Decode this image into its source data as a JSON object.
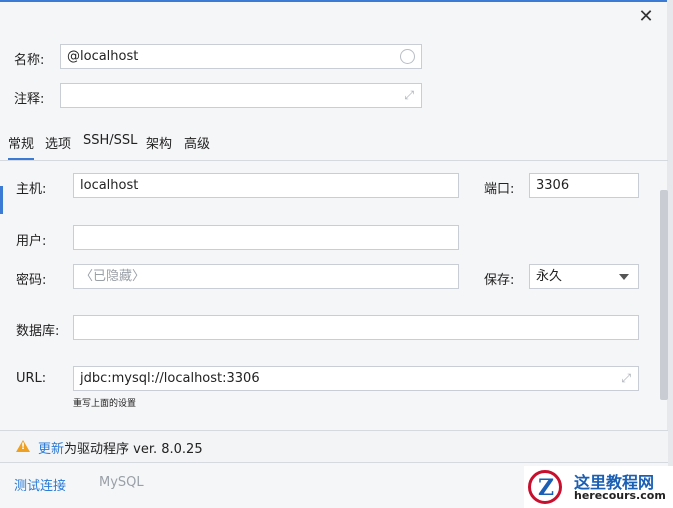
{
  "window": {
    "close_glyph": "✕"
  },
  "header": {
    "name_label": "名称:",
    "name_value": "@localhost",
    "comment_label": "注释:",
    "comment_value": ""
  },
  "tabs": [
    {
      "label": "常规",
      "active": true
    },
    {
      "label": "选项"
    },
    {
      "label": "SSH/SSL"
    },
    {
      "label": "架构"
    },
    {
      "label": "高级"
    }
  ],
  "form": {
    "host_label": "主机:",
    "host_value": "localhost",
    "port_label": "端口:",
    "port_value": "3306",
    "user_label": "用户:",
    "user_value": "",
    "password_label": "密码:",
    "password_placeholder": "〈已隐藏〉",
    "save_label": "保存:",
    "save_value": "永久",
    "database_label": "数据库:",
    "database_value": "",
    "url_label": "URL:",
    "url_value": "jdbc:mysql://localhost:3306",
    "url_hint": "重写上面的设置"
  },
  "update": {
    "link_text": "更新",
    "message": "为驱动程序 ver. 8.0.25"
  },
  "footer": {
    "test_connection": "测试连接",
    "driver_name": "MySQL"
  },
  "watermark": {
    "logo_letter": "Z",
    "title": "这里教程网",
    "url": "herecours.com"
  },
  "colors": {
    "accent": "#3b7bd6",
    "warning": "#f0a020",
    "link": "#2a7ad6"
  }
}
